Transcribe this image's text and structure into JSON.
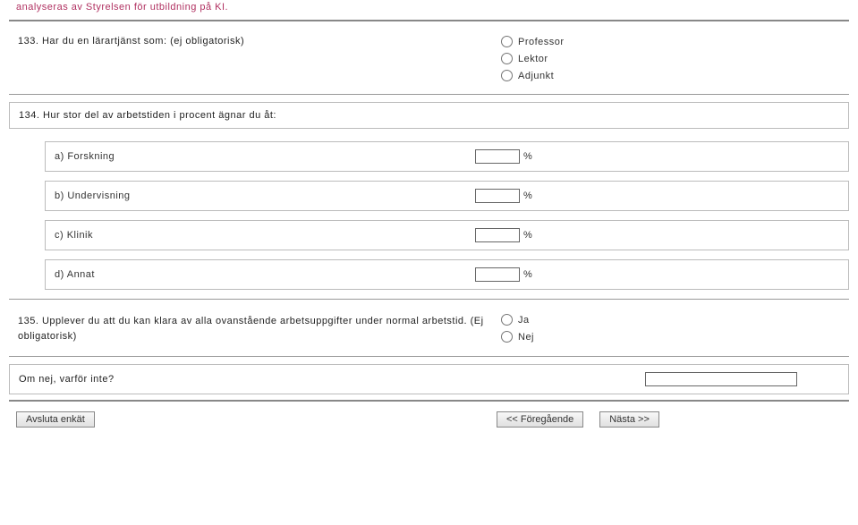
{
  "truncated_header": "analyseras av Styrelsen för utbildning på KI.",
  "q133": {
    "label": "133. Har du en lärartjänst som: (ej obligatorisk)",
    "options": [
      "Professor",
      "Lektor",
      "Adjunkt"
    ]
  },
  "q134": {
    "label": "134. Hur stor del av arbetstiden i procent ägnar du åt:",
    "items": [
      {
        "label": "a) Forskning",
        "unit": "%"
      },
      {
        "label": "b) Undervisning",
        "unit": "%"
      },
      {
        "label": "c) Klinik",
        "unit": "%"
      },
      {
        "label": "d) Annat",
        "unit": "%"
      }
    ]
  },
  "q135": {
    "label": "135. Upplever du att du kan klara av alla ovanstående arbetsuppgifter under normal arbetstid. (Ej obligatorisk)",
    "options": [
      "Ja",
      "Nej"
    ]
  },
  "q_followup": {
    "label": "Om nej, varför inte?"
  },
  "footer": {
    "end": "Avsluta enkät",
    "prev": "<< Föregående",
    "next": "Nästa >>"
  }
}
